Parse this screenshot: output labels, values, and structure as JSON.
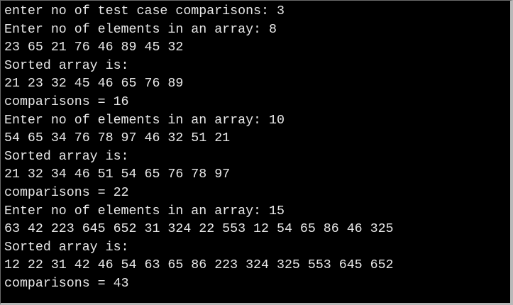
{
  "terminal": {
    "background": "#000000",
    "foreground": "#e8e8e8",
    "lines": [
      "enter no of test case comparisons: 3",
      "Enter no of elements in an array: 8",
      "23 65 21 76 46 89 45 32",
      "Sorted array is:",
      "21 23 32 45 46 65 76 89",
      "comparisons = 16",
      "Enter no of elements in an array: 10",
      "54 65 34 76 78 97 46 32 51 21",
      "Sorted array is:",
      "21 32 34 46 51 54 65 76 78 97",
      "comparisons = 22",
      "Enter no of elements in an array: 15",
      "63 42 223 645 652 31 324 22 553 12 54 65 86 46 325",
      "Sorted array is:",
      "12 22 31 42 46 54 63 65 86 223 324 325 553 645 652",
      "comparisons = 43"
    ]
  }
}
